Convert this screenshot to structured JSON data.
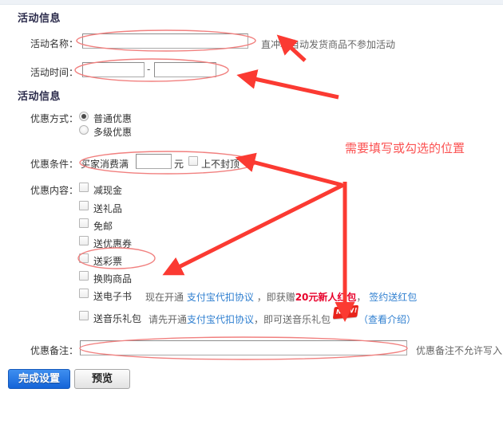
{
  "page": {
    "title_activity_info": "活动信息",
    "title_promo_info": "活动信息"
  },
  "form": {
    "activity_name": {
      "label": "活动名称：",
      "value": "",
      "placeholder": "",
      "hint": "直冲和自动发货商品不参加活动"
    },
    "activity_time": {
      "label": "活动时间：",
      "start_value": "",
      "end_value": "",
      "separator": "-"
    },
    "promo_mode": {
      "label": "优惠方式：",
      "options": [
        {
          "label": "普通优惠",
          "checked": true
        },
        {
          "label": "多级优惠",
          "checked": false
        }
      ]
    },
    "promo_condition": {
      "label": "优惠条件：",
      "prefix_text": "买家消费满",
      "amount_value": "",
      "unit_text": "元",
      "no_cap": {
        "label": "上不封顶",
        "checked": false
      }
    },
    "promo_content": {
      "label": "优惠内容：",
      "items": [
        {
          "label": "减现金",
          "checked": false
        },
        {
          "label": "送礼品",
          "checked": false
        },
        {
          "label": "免邮",
          "checked": false
        },
        {
          "label": "送优惠券",
          "checked": false
        },
        {
          "label": "送彩票",
          "checked": false
        },
        {
          "label": "换购商品",
          "checked": false
        },
        {
          "label": "送电子书",
          "checked": false
        },
        {
          "label": "送音乐礼包",
          "checked": false
        }
      ],
      "ebook_note": {
        "part1": "现在开通",
        "link1": "支付宝代扣协议",
        "part2": "，即获赠",
        "highlight": "20元新人红包",
        "part3": "，",
        "link2": "签约送红包"
      },
      "music_note": {
        "part1": "请先开通",
        "link1": "支付宝代扣协议",
        "part2": "，即可送音乐礼包",
        "badge": "NEW!",
        "link2": "（查看介绍）"
      }
    },
    "promo_remark": {
      "label": "优惠备注：",
      "value": "",
      "placeholder": "",
      "hint": "优惠备注不允许写入"
    }
  },
  "buttons": {
    "finish": "完成设置",
    "preview": "预览"
  },
  "annotation": {
    "text": "需要填写或勾选的位置",
    "color": "#fb5252"
  }
}
